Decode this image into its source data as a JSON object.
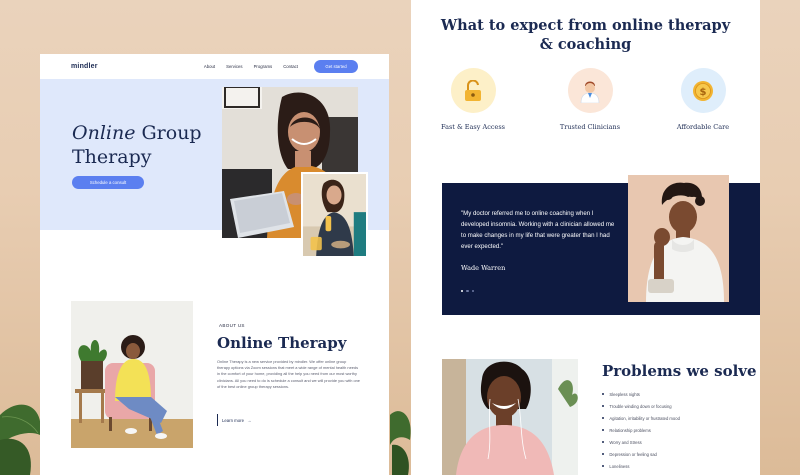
{
  "colors": {
    "accent": "#5b7ff0",
    "navy": "#0e1a40",
    "hero_bg": "#dfe8fb",
    "background": "#e8cdb2"
  },
  "left": {
    "nav": {
      "logo": "mindler",
      "links": [
        "About",
        "Services",
        "Programs",
        "Contact"
      ],
      "cta": "Get started"
    },
    "hero": {
      "title_italic": "Online",
      "title_rest": " Group",
      "title_line2": "Therapy",
      "cta": "Schedule a consult"
    },
    "about": {
      "eyebrow": "ABOUT US",
      "title": "Online Therapy",
      "body": "Online Therapy is a new service provided by mindler. We offer online group therapy options via Zoom sessions that meet a wide range of mental health needs in the comfort of your home, providing all the help you need from our most worthy clinicians. All you need to do is schedule a consult and we will provide you with one of the best online group therapy sessions.",
      "more": "Learn more",
      "more_arrow": "→"
    }
  },
  "right": {
    "expect_title_line1": "What to expect from online therapy",
    "expect_title_line2": "& coaching",
    "features": [
      {
        "label": "Fast & Easy Access",
        "icon": "unlock-icon",
        "bg": "#fdf0c8"
      },
      {
        "label": "Trusted Clinicians",
        "icon": "doctor-icon",
        "bg": "#fbe6d8"
      },
      {
        "label": "Affordable Care",
        "icon": "coin-icon",
        "bg": "#dfeefb"
      }
    ],
    "testimonial": {
      "quote": "\"My doctor referred me to online coaching when I developed insomnia. Working with a clinician allowed me to make changes in my life that were greater than I had ever expected.\"",
      "author": "Wade Warren"
    },
    "problems": {
      "title": "Problems we solve",
      "items": [
        "Sleepless nights",
        "Trouble winding down or focusing",
        "Agitation, irritability or frustrated mood",
        "Relationship problems",
        "Worry and Stress",
        "Depression or feeling sad",
        "Loneliness"
      ]
    }
  }
}
